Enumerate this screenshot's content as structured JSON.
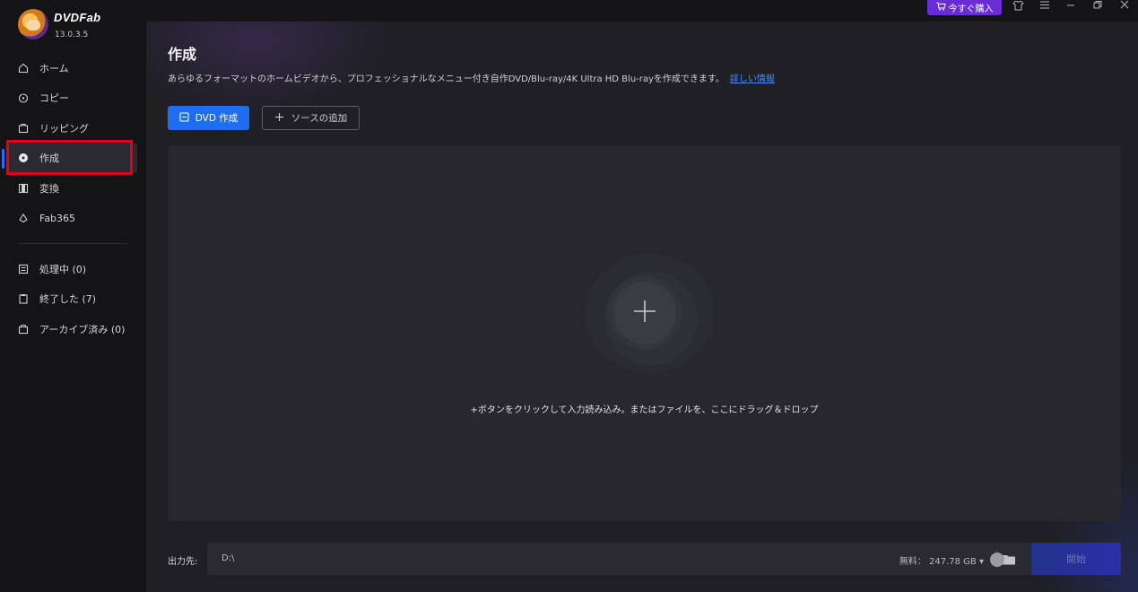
{
  "app": {
    "name": "DVDFab",
    "version": "13.0.3.5"
  },
  "sidebar": {
    "items": [
      {
        "label": "ホーム",
        "icon": "home-icon"
      },
      {
        "label": "コピー",
        "icon": "copy-icon"
      },
      {
        "label": "リッピング",
        "icon": "ripper-icon"
      },
      {
        "label": "作成",
        "icon": "creator-icon",
        "active": true
      },
      {
        "label": "変換",
        "icon": "converter-icon"
      },
      {
        "label": "Fab365",
        "icon": "fab365-icon"
      }
    ],
    "queue": [
      {
        "label": "処理中 (0)",
        "icon": "processing-icon"
      },
      {
        "label": "終了した (7)",
        "icon": "finished-icon"
      },
      {
        "label": "アーカイブ済み (0)",
        "icon": "archive-icon"
      }
    ]
  },
  "topbar": {
    "buy_label": "今すぐ購入"
  },
  "main": {
    "title": "作成",
    "description": "あらゆるフォーマットのホームビデオから、プロフェッショナルなメニュー付き自作DVD/Blu-ray/4K Ultra HD Blu-rayを作成できます。",
    "more_link": "詳しい情報 ",
    "dvd_button": "DVD 作成",
    "add_source_button": "ソースの追加",
    "drop_hint": "+ボタンをクリックして入力読み込み。またはファイルを、ここにドラッグ＆ドロップ"
  },
  "output": {
    "label": "出力先:",
    "path": "D:\\",
    "free_space": "無料：  247.78 GB",
    "start_button": "開始"
  },
  "colors": {
    "accent": "#1f6df2",
    "buy": "#6a2bd9",
    "highlight": "#e3001b"
  }
}
